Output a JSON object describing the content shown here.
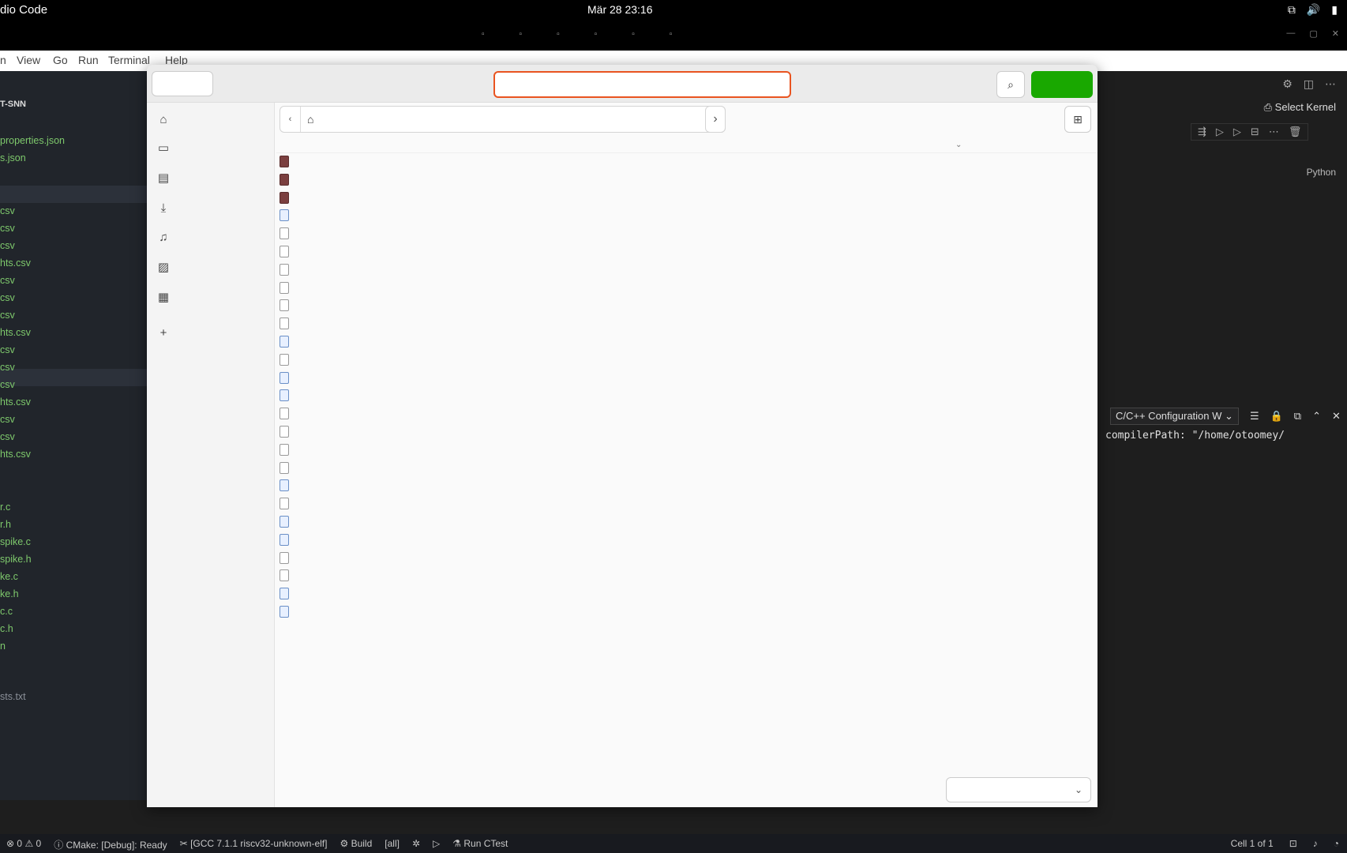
{
  "topbar": {
    "app_name": "dio Code",
    "clock": "Mär 28  23:16"
  },
  "menubar": {
    "items": [
      "n",
      "View",
      "Go",
      "Run",
      "Terminal",
      "Help"
    ]
  },
  "sidebar": {
    "project": "T-SNN",
    "files": [
      "properties.json",
      "s.json",
      "csv",
      "csv",
      "csv",
      "hts.csv",
      "csv",
      "csv",
      "csv",
      "hts.csv",
      "csv",
      "csv",
      "csv",
      "hts.csv",
      "csv",
      "csv",
      "hts.csv",
      "r.c",
      "r.h",
      "spike.c",
      "spike.h",
      "ke.c",
      "ke.h",
      "c.c",
      "c.h",
      "n",
      "sts.txt"
    ]
  },
  "editor": {
    "select_kernel": "Select Kernel",
    "language": "Python",
    "output_channel": "C/C++ Configuration W",
    "output_line": "compilerPath: \"/home/otoomey/"
  },
  "statusbar": {
    "problems": "0",
    "warnings": "0",
    "cmake": "CMake: [Debug]: Ready",
    "kit": "[GCC 7.1.1 riscv32-unknown-elf]",
    "build": "Build",
    "target": "[all]",
    "ctest": "Run CTest",
    "cell": "Cell 1 of 1"
  }
}
